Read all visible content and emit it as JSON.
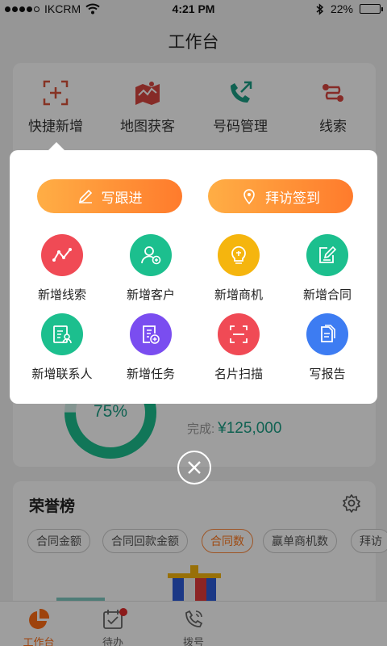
{
  "status": {
    "carrier": "IKCRM",
    "time": "4:21 PM",
    "battery_text": "22%",
    "battery_level": 0.22
  },
  "header": {
    "title": "工作台"
  },
  "quick_actions": [
    {
      "label": "快捷新增",
      "icon": "quick-add-icon"
    },
    {
      "label": "地图获客",
      "icon": "map-icon"
    },
    {
      "label": "号码管理",
      "icon": "phone-arrow-icon"
    },
    {
      "label": "线索",
      "icon": "clue-icon"
    }
  ],
  "popup": {
    "buttons": [
      {
        "label": "写跟进",
        "icon": "pencil-icon"
      },
      {
        "label": "拜访签到",
        "icon": "location-pin-icon"
      }
    ],
    "grid": [
      {
        "label": "新增线索",
        "icon": "line-chart-icon",
        "color": "#f04a55"
      },
      {
        "label": "新增客户",
        "icon": "add-user-icon",
        "color": "#1cbf8e"
      },
      {
        "label": "新增商机",
        "icon": "lightbulb-icon",
        "color": "#f5b50e"
      },
      {
        "label": "新增合同",
        "icon": "contract-edit-icon",
        "color": "#1cbf8e"
      },
      {
        "label": "新增联系人",
        "icon": "contact-card-icon",
        "color": "#1cbf8e"
      },
      {
        "label": "新增任务",
        "icon": "add-task-icon",
        "color": "#7a4df0"
      },
      {
        "label": "名片扫描",
        "icon": "scan-icon",
        "color": "#f04a55"
      },
      {
        "label": "写报告",
        "icon": "report-icon",
        "color": "#3d7cf2"
      }
    ]
  },
  "progress": {
    "percent_text": "75%",
    "percent": 0.75,
    "done_label": "完成:",
    "done_value": "¥125,000"
  },
  "honor": {
    "title": "荣誉榜",
    "chips": [
      "合同金额",
      "合同回款金额",
      "合同数",
      "赢单商机数",
      "拜访"
    ],
    "active_chip_index": 2
  },
  "tabs": [
    {
      "label": "工作台",
      "icon": "workbench-pie-icon"
    },
    {
      "label": "待办",
      "icon": "todo-calendar-icon"
    },
    {
      "label": "拨号",
      "icon": "dial-phone-icon"
    }
  ],
  "colors": {
    "accent": "#ff7a20",
    "green": "#1cbf8e"
  }
}
